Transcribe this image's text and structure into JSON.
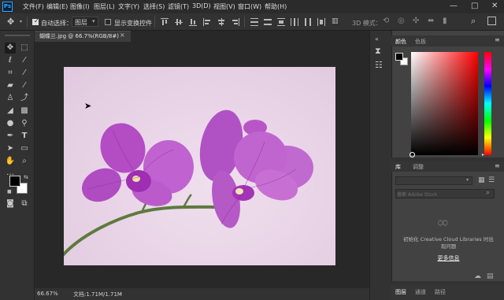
{
  "app": {
    "logo": "Ps"
  },
  "menu": [
    "文件(F)",
    "编辑(E)",
    "图像(I)",
    "图层(L)",
    "文字(Y)",
    "选择(S)",
    "滤镜(T)",
    "3D(D)",
    "视图(V)",
    "窗口(W)",
    "帮助(H)"
  ],
  "window_controls": {
    "minimize": "—",
    "maximize": "□",
    "close": "✕"
  },
  "options": {
    "auto_select_label": "自动选择：",
    "auto_select_target": "图层",
    "show_transform_label": "显示变换控件",
    "mode_3d_label": "3D 模式："
  },
  "document": {
    "tab_title": "蝴蝶兰.jpg @ 66.7%(RGB/8#)",
    "tab_close": "×",
    "zoom": "66.67%",
    "doc_info": "文档:1.71M/1.71M"
  },
  "panels": {
    "color_tab": "颜色",
    "swatches_tab": "色板",
    "libraries_tab": "库",
    "adjustments_tab": "调整",
    "search_placeholder": "搜索 Adobe Stock",
    "init_message_line1": "初始化 Creative Cloud Libraries 时出",
    "init_message_line2": "现问题",
    "more_info": "更多信息",
    "bottom_tabs": [
      "图层",
      "通道",
      "路径"
    ]
  },
  "colors": {
    "foreground": "#000000",
    "background": "#ffffff",
    "accent": "#31a8ff",
    "petal": "#b84fc6",
    "canvas_bg": "#e8d3e6"
  },
  "icons": [
    "move-icon",
    "marquee-icon",
    "lasso-icon",
    "magic-wand-icon",
    "crop-icon",
    "eyedropper-icon",
    "healing-icon",
    "brush-icon",
    "stamp-icon",
    "history-brush-icon",
    "eraser-icon",
    "gradient-icon",
    "blur-icon",
    "dodge-icon",
    "pen-icon",
    "type-icon",
    "path-select-icon",
    "shape-icon",
    "hand-icon",
    "zoom-icon",
    "more-icon",
    "quickmask-icon",
    "screenmode-icon"
  ]
}
